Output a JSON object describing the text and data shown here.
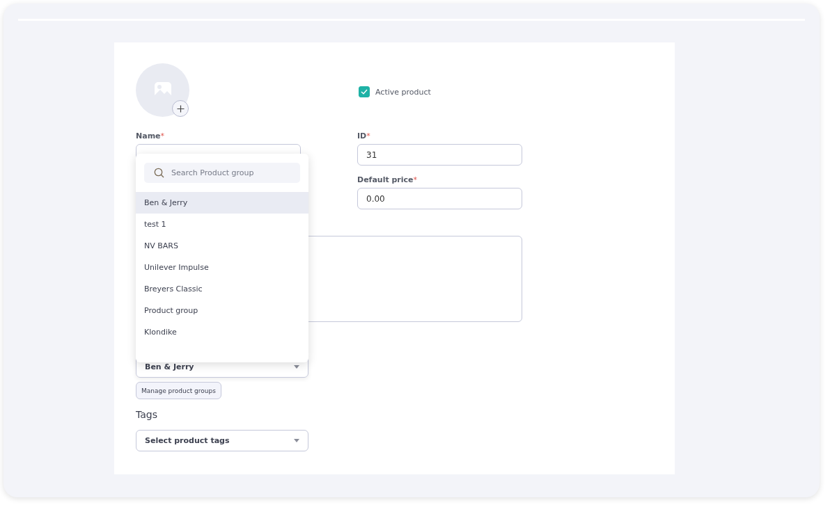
{
  "active_product": {
    "label": "Active product",
    "checked": true
  },
  "name": {
    "label": "Name",
    "required_mark": "*"
  },
  "id": {
    "label": "ID",
    "required_mark": "*",
    "value": "31"
  },
  "default_price": {
    "label": "Default price",
    "required_mark": "*",
    "value": "0.00"
  },
  "product_group_dropdown": {
    "search_placeholder": "Search Product group",
    "items": [
      {
        "label": "Ben & Jerry",
        "selected": true
      },
      {
        "label": "test 1",
        "selected": false
      },
      {
        "label": "NV BARS",
        "selected": false
      },
      {
        "label": "Unilever Impulse",
        "selected": false
      },
      {
        "label": "Breyers Classic",
        "selected": false
      },
      {
        "label": "Product group",
        "selected": false
      },
      {
        "label": "Klondike",
        "selected": false
      }
    ]
  },
  "product_group": {
    "value": "Ben & Jerry",
    "manage_button": "Manage product groups"
  },
  "tags": {
    "label": "Tags",
    "placeholder": "Select product tags"
  }
}
